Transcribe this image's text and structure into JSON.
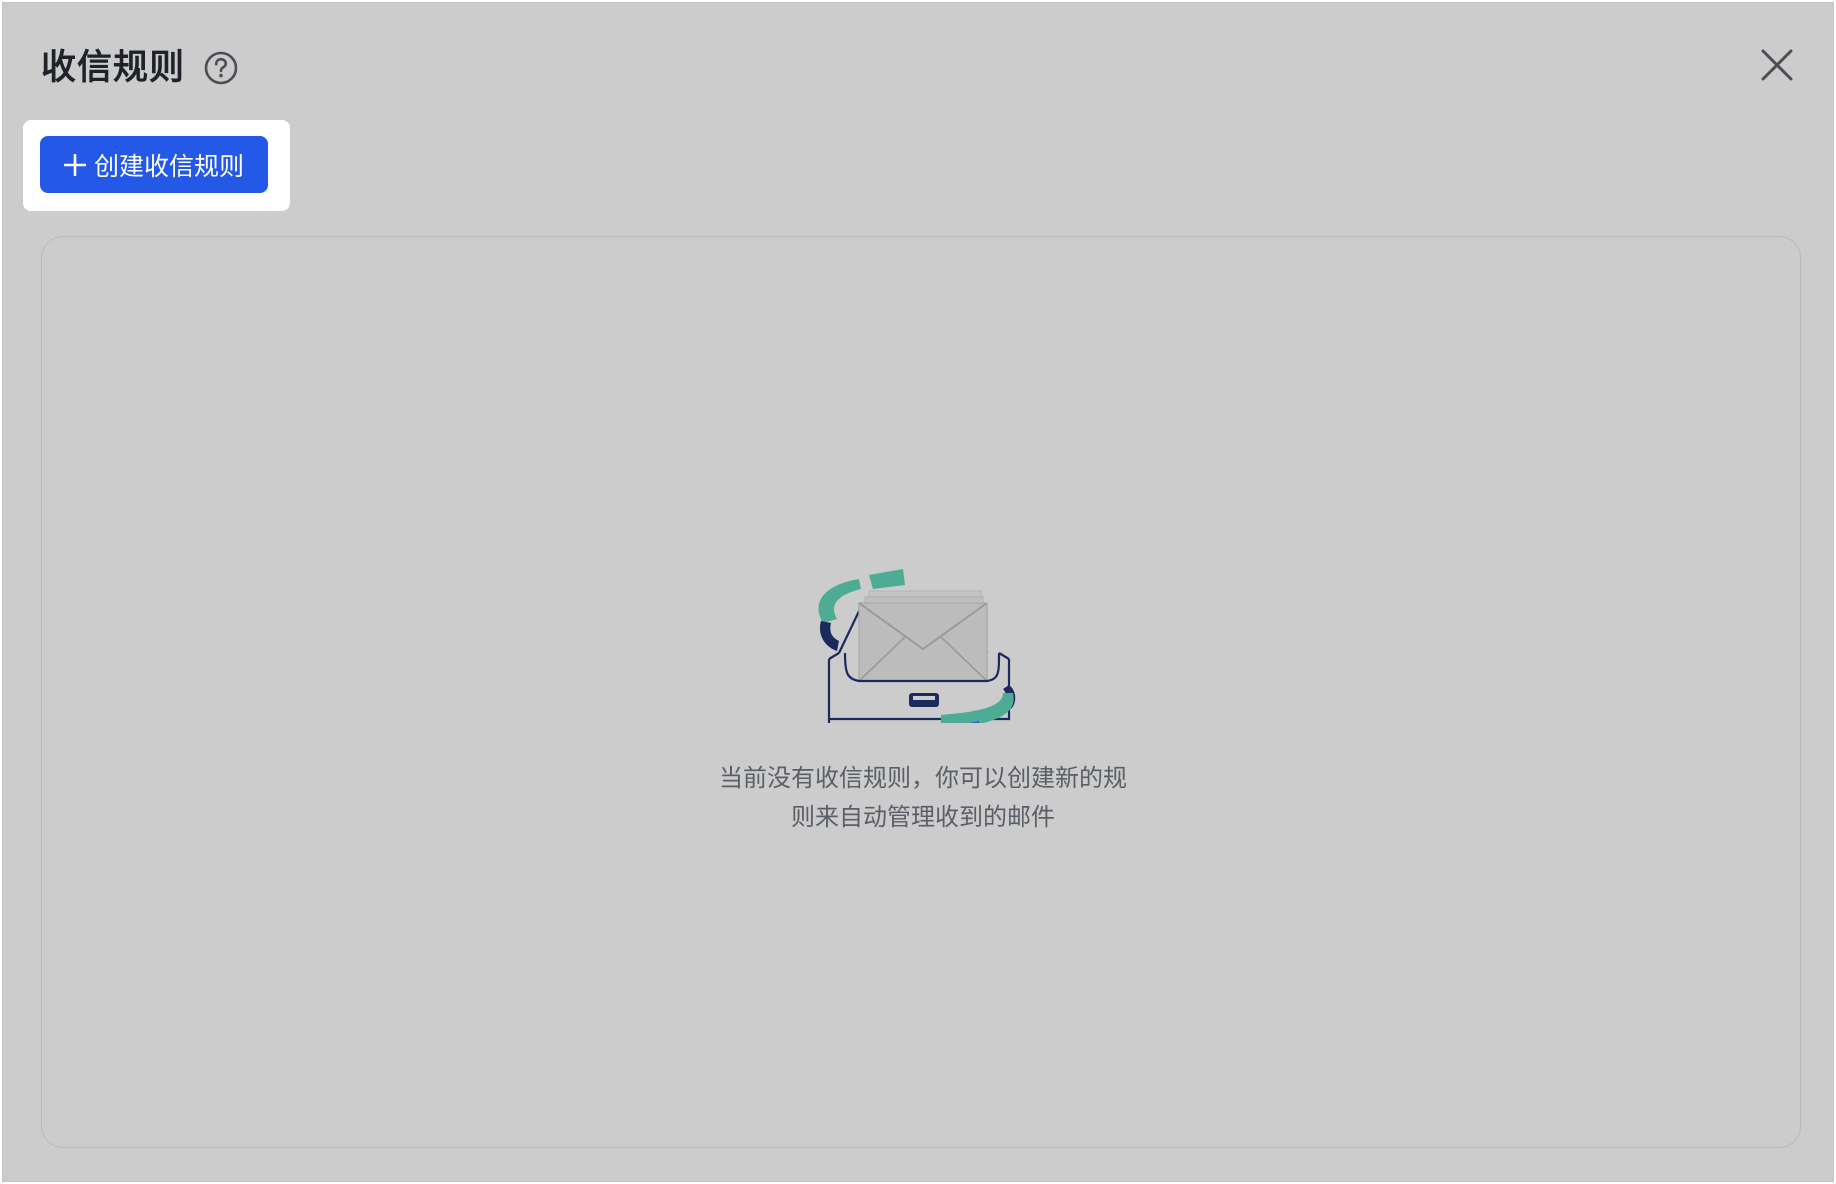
{
  "dialog": {
    "title": "收信规则",
    "help_icon": "question-circle-icon",
    "close_icon": "close-icon"
  },
  "toolbar": {
    "create_label": "创建收信规则",
    "create_icon": "plus-icon"
  },
  "empty_state": {
    "illustration": "inbox-envelope-illustration",
    "line1": "当前没有收信规则，你可以创建新的规",
    "line2": "则来自动管理收到的邮件"
  },
  "colors": {
    "accent": "#2458e6",
    "overlay_bg": "#cccccc",
    "teal": "#4eac94",
    "navy": "#1a2a5c"
  }
}
